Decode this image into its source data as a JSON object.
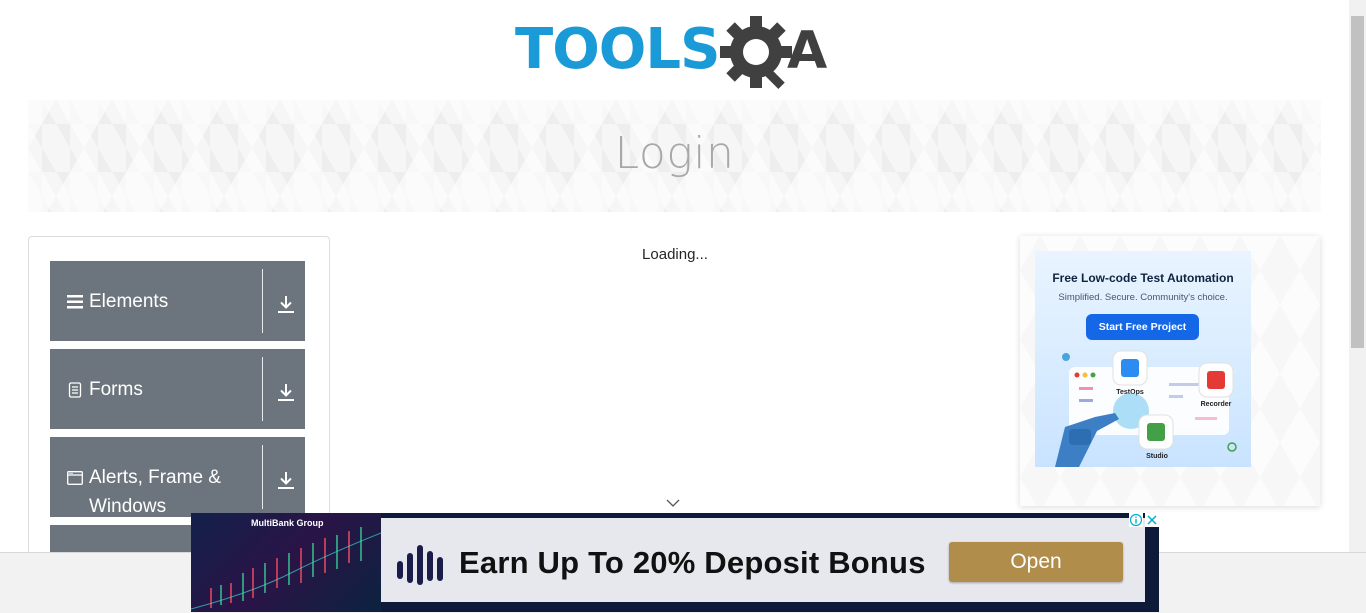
{
  "header": {
    "logo_alt": "TOOLSQA",
    "logo_text_left": "TOOLS",
    "logo_text_right": "A"
  },
  "banner": {
    "title": "Login"
  },
  "sidebar": {
    "groups": [
      {
        "label": "Elements",
        "icon": "hamburger-icon"
      },
      {
        "label": "Forms",
        "icon": "document-icon"
      },
      {
        "label": "Alerts, Frame & Windows",
        "icon": "window-icon"
      }
    ]
  },
  "main": {
    "loading_text": "Loading..."
  },
  "right_ad": {
    "headline": "Free Low-code Test Automation",
    "subtext": "Simplified. Secure. Community's choice.",
    "cta": "Start Free Project",
    "labels": [
      "TestOps",
      "Recorder",
      "Studio"
    ],
    "colors": {
      "cta": "#1468e8",
      "testops": "#2d8cf0",
      "recorder": "#e53935",
      "studio": "#43a047"
    }
  },
  "bottom_ad": {
    "brand": "MultiBank Group",
    "headline": "Earn Up To 20% Deposit Bonus",
    "button": "Open",
    "colors": {
      "button": "#b08d4a"
    }
  },
  "colors": {
    "sidebar_bg": "#6c757d",
    "logo_blue": "#1a9ad6",
    "logo_dark": "#404040"
  }
}
